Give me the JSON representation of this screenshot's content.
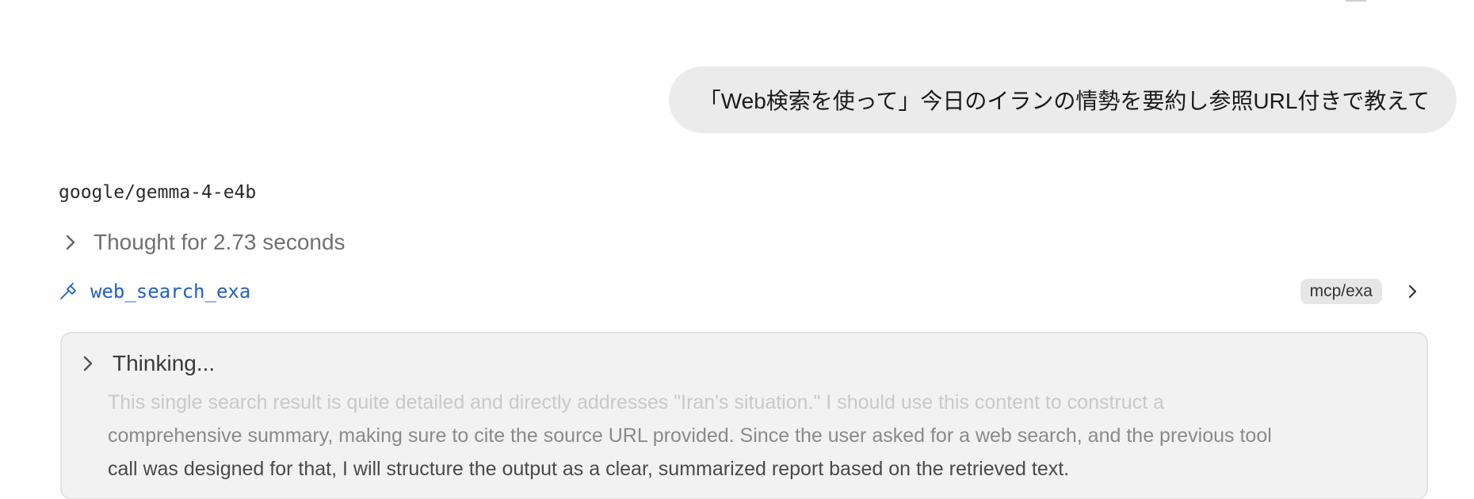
{
  "user_message": {
    "text": "「Web検索を使って」今日のイランの情勢を要約し参照URL付きで教えて"
  },
  "response": {
    "model_name": "google/gemma-4-e4b",
    "thought": {
      "label": "Thought for 2.73 seconds",
      "icon": "chevron-right-icon"
    },
    "tool_call": {
      "icon": "hammer-icon",
      "name": "web_search_exa",
      "badge": "mcp/exa",
      "expand_icon": "chevron-right-icon",
      "name_color": "#1f5fd6"
    },
    "thinking": {
      "label": "Thinking...",
      "lines": [
        "This single search result is quite detailed and directly addresses \"Iran's situation.\" I should use this content to construct a",
        "comprehensive summary, making sure to cite the source URL provided. Since the user asked for a web search, and the previous tool",
        "call was designed for that, I will structure the output as a clear, summarized report based on the retrieved text."
      ]
    }
  }
}
